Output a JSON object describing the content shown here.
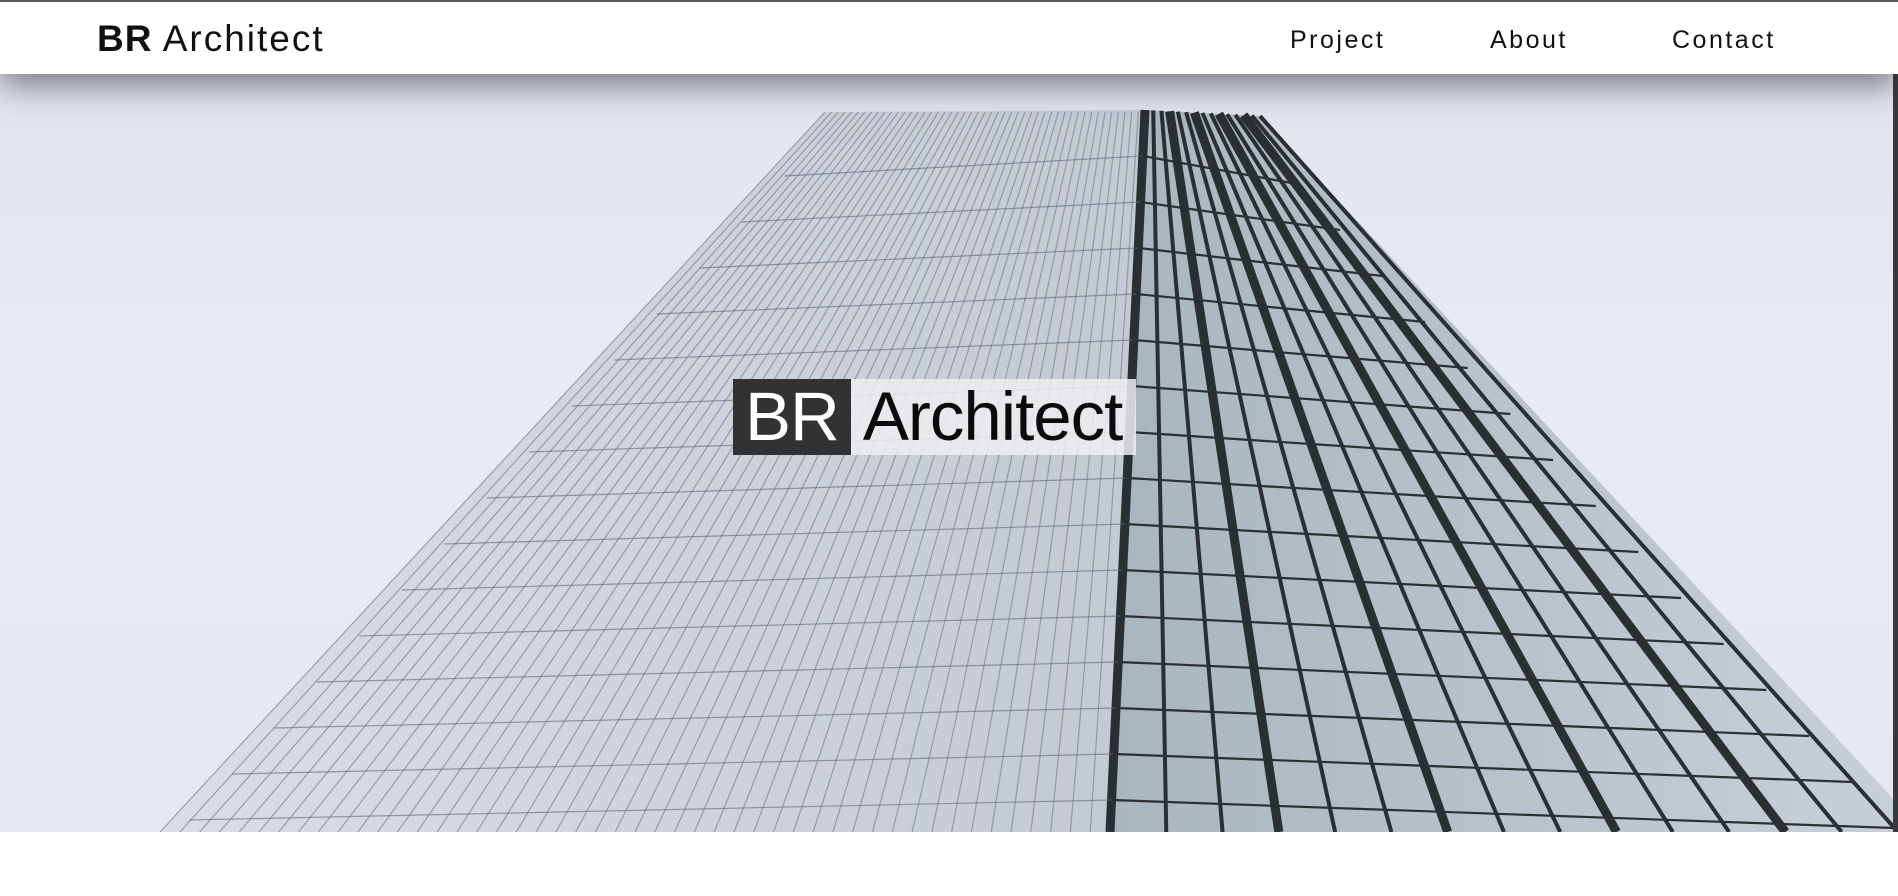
{
  "header": {
    "brand_bold": "BR",
    "brand_rest": "Architect",
    "nav": [
      {
        "label": "Project"
      },
      {
        "label": "About"
      },
      {
        "label": "Contact"
      }
    ]
  },
  "hero": {
    "title_bold": "BR",
    "title_rest": "Architect",
    "image": "glass-skyscraper-photo"
  },
  "colors": {
    "header_bg": "#ffffff",
    "title_dark_box": "#323234",
    "text": "#111111",
    "sky": "#e6e8f0",
    "glass": "#b9c4cc",
    "frame": "#2a2f31"
  }
}
